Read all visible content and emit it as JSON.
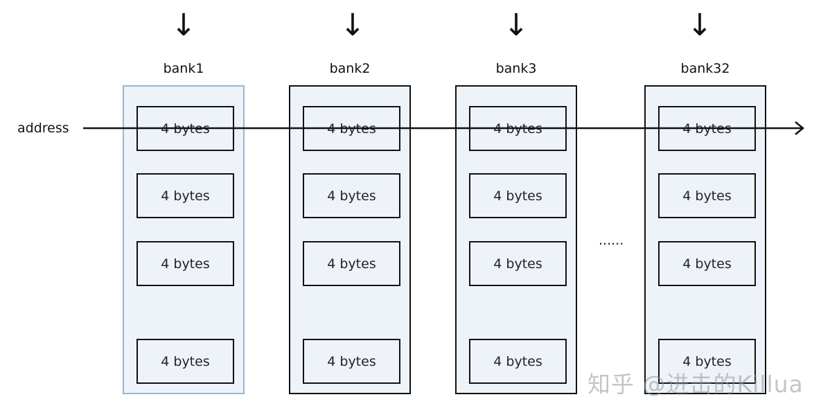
{
  "address_label": "address",
  "ellipsis": "......",
  "banks": [
    {
      "label": "bank1",
      "highlighted": true,
      "cells": [
        "4 bytes",
        "4 bytes",
        "4 bytes",
        "4 bytes"
      ]
    },
    {
      "label": "bank2",
      "highlighted": false,
      "cells": [
        "4 bytes",
        "4 bytes",
        "4 bytes",
        "4 bytes"
      ]
    },
    {
      "label": "bank3",
      "highlighted": false,
      "cells": [
        "4 bytes",
        "4 bytes",
        "4 bytes",
        "4 bytes"
      ]
    },
    {
      "label": "bank32",
      "highlighted": false,
      "cells": [
        "4 bytes",
        "4 bytes",
        "4 bytes",
        "4 bytes"
      ]
    }
  ],
  "arrow_glyph": "↓",
  "watermark": "知乎 @进击的Killua",
  "colors": {
    "highlight_border": "#9fb3d6",
    "bank_fill": "#eef3fa"
  }
}
